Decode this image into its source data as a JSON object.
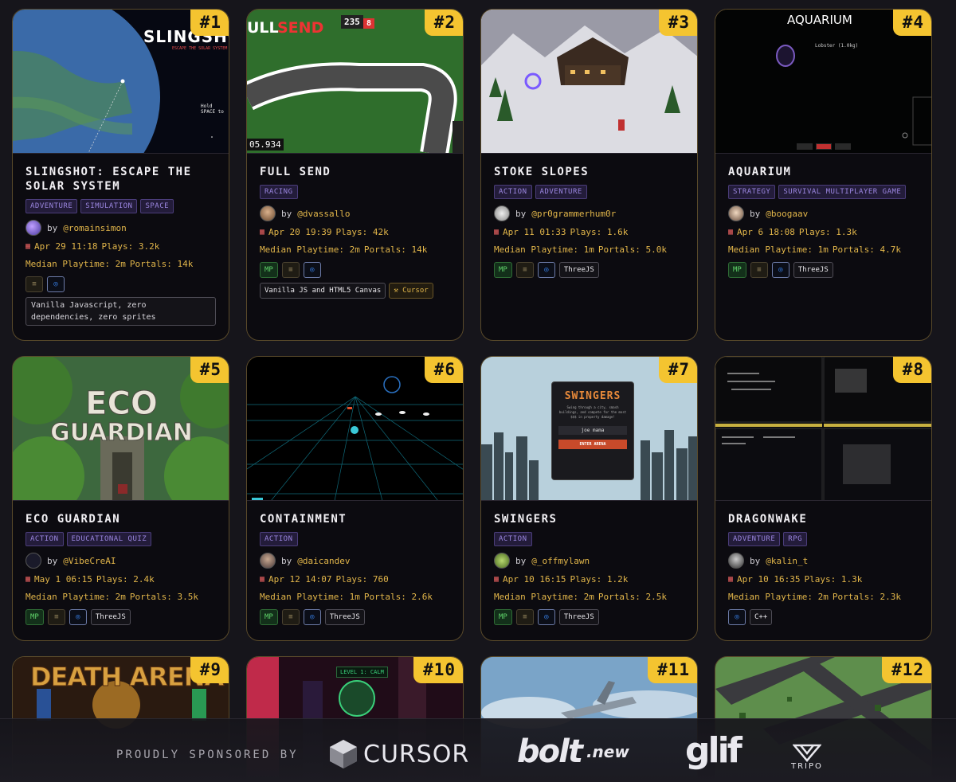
{
  "games": [
    {
      "rank": "#1",
      "title": "SLINGSHOT: ESCAPE THE SOLAR SYSTEM",
      "tags": [
        "ADVENTURE",
        "SIMULATION",
        "SPACE"
      ],
      "by": "by",
      "author": "@romainsimon",
      "date": "Apr 29 11:18",
      "plays": "Plays: 3.2k",
      "median": "Median Playtime: 2m",
      "portals": "Portals: 14k",
      "note": "Vanilla Javascript, zero dependencies, zero sprites",
      "thumb_text": "SLINGSHOT",
      "thumb_sub": "ESCAPE THE SOLAR SYSTEM",
      "thumb_hint": "Hold SPACE to"
    },
    {
      "rank": "#2",
      "title": "FULL SEND",
      "tags": [
        "RACING"
      ],
      "by": "by",
      "author": "@dvassallo",
      "date": "Apr 20 19:39",
      "plays": "Plays: 42k",
      "median": "Median Playtime: 2m",
      "portals": "Portals: 14k",
      "tech": [
        "Vanilla JS and HTML5 Canvas"
      ],
      "cursor_label": "Cursor",
      "thumb_text": "ULL",
      "thumb_text2": "SEND",
      "thumb_score": "235",
      "thumb_lives": "8",
      "thumb_time": "05.934"
    },
    {
      "rank": "#3",
      "title": "STOKE SLOPES",
      "tags": [
        "ACTION",
        "ADVENTURE"
      ],
      "by": "by",
      "author": "@pr0grammerhum0r",
      "date": "Apr 11 01:33",
      "plays": "Plays: 1.6k",
      "median": "Median Playtime: 1m",
      "portals": "Portals: 5.0k",
      "tech": [
        "ThreeJS"
      ]
    },
    {
      "rank": "#4",
      "title": "AQUARIUM",
      "tags": [
        "STRATEGY",
        "SURVIVAL MULTIPLAYER GAME"
      ],
      "by": "by",
      "author": "@boogaav",
      "date": "Apr 6 18:08",
      "plays": "Plays: 1.3k",
      "median": "Median Playtime: 1m",
      "portals": "Portals: 4.7k",
      "tech": [
        "ThreeJS"
      ],
      "thumb_text": "AQUARIUM",
      "thumb_label": "Lobster (1.0kg)"
    },
    {
      "rank": "#5",
      "title": "ECO GUARDIAN",
      "tags": [
        "ACTION",
        "EDUCATIONAL QUIZ"
      ],
      "by": "by",
      "author": "@VibeCreAI",
      "date": "May 1 06:15",
      "plays": "Plays: 2.4k",
      "median": "Median Playtime: 2m",
      "portals": "Portals: 3.5k",
      "tech": [
        "ThreeJS"
      ],
      "thumb_text": "ECO",
      "thumb_text2": "GUARDIAN"
    },
    {
      "rank": "#6",
      "title": "CONTAINMENT",
      "tags": [
        "ACTION"
      ],
      "by": "by",
      "author": "@daicandev",
      "date": "Apr 12 14:07",
      "plays": "Plays: 760",
      "median": "Median Playtime: 1m",
      "portals": "Portals: 2.6k",
      "tech": [
        "ThreeJS"
      ]
    },
    {
      "rank": "#7",
      "title": "SWINGERS",
      "tags": [
        "ACTION"
      ],
      "by": "by",
      "author": "@_offmylawn",
      "date": "Apr 10 16:15",
      "plays": "Plays: 1.2k",
      "median": "Median Playtime: 2m",
      "portals": "Portals: 2.5k",
      "tech": [
        "ThreeJS"
      ],
      "thumb_text": "SWINGERS",
      "thumb_sub": "Swing through a city, smash buildings, and compete for the most $$$ in property damage!",
      "thumb_input": "joe mama",
      "thumb_btn": "ENTER ARENA"
    },
    {
      "rank": "#8",
      "title": "DRAGONWAKE",
      "tags": [
        "ADVENTURE",
        "RPG"
      ],
      "by": "by",
      "author": "@kalin_t",
      "date": "Apr 10 16:35",
      "plays": "Plays: 1.3k",
      "median": "Median Playtime: 2m",
      "portals": "Portals: 2.3k",
      "tech": [
        "C++"
      ]
    },
    {
      "rank": "#9",
      "thumb_text": "DEATH ARENA"
    },
    {
      "rank": "#10",
      "thumb_text": "LEVEL 1: CALM"
    },
    {
      "rank": "#11"
    },
    {
      "rank": "#12"
    }
  ],
  "badge_mp": "MP",
  "footer": {
    "label": "PROUDLY SPONSORED BY",
    "sponsors": [
      "CURSOR",
      "bolt",
      ".new",
      "glif",
      "TRIPO"
    ]
  },
  "colors": {
    "accent": "#f4c430",
    "tag": "#9b86e0",
    "meta": "#e2b64a",
    "mp": "#5fd46a"
  }
}
